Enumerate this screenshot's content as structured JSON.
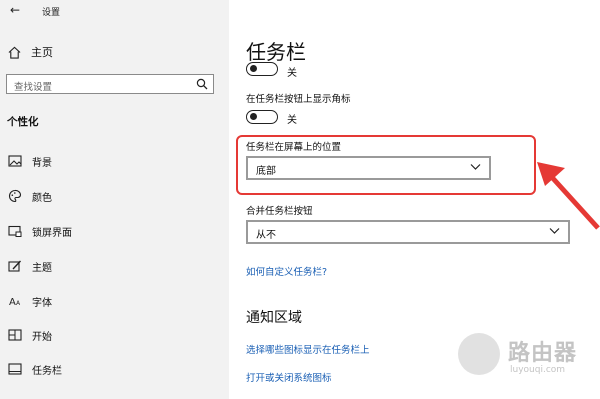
{
  "titlebar": {
    "back_icon": "←",
    "title": "设置"
  },
  "sidebar": {
    "home_label": "主页",
    "search_placeholder": "查找设置",
    "section_title": "个性化",
    "items": [
      {
        "label": "背景",
        "icon": "picture-icon"
      },
      {
        "label": "颜色",
        "icon": "palette-icon"
      },
      {
        "label": "锁屏界面",
        "icon": "lock-screen-icon"
      },
      {
        "label": "主题",
        "icon": "theme-brush-icon"
      },
      {
        "label": "字体",
        "icon": "font-icon"
      },
      {
        "label": "开始",
        "icon": "start-menu-icon"
      },
      {
        "label": "任务栏",
        "icon": "taskbar-icon"
      }
    ]
  },
  "main": {
    "page_title": "任务栏",
    "top_toggle_label": "关",
    "badges_setting": {
      "label": "在任务栏按钮上显示角标",
      "toggle_label": "关",
      "state": "off"
    },
    "location_setting": {
      "label": "任务栏在屏幕上的位置",
      "value": "底部"
    },
    "combine_setting": {
      "label": "合并任务栏按钮",
      "value": "从不"
    },
    "customize_link": "如何自定义任务栏?",
    "notification_heading": "通知区域",
    "notification_links": [
      "选择哪些图标显示在任务栏上",
      "打开或关闭系统图标"
    ]
  },
  "colors": {
    "highlight": "#e53935",
    "link": "#1a5fb4",
    "sidebar_bg": "#f2f2f2"
  },
  "watermark": {
    "title": "路由器",
    "sub": "luyouqi.com"
  }
}
